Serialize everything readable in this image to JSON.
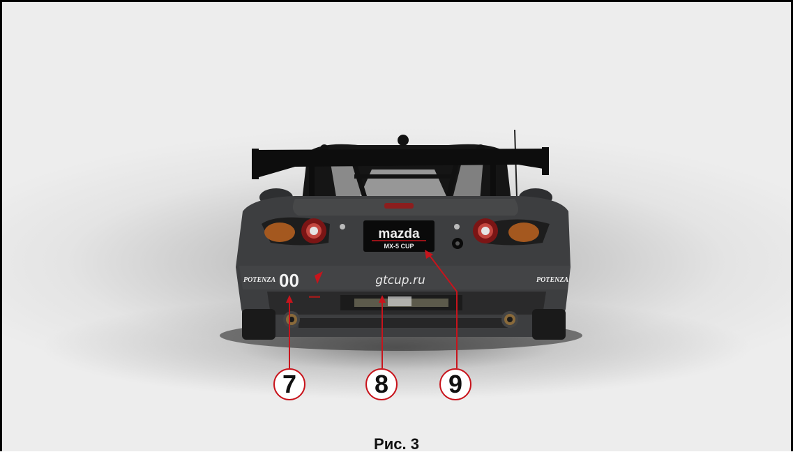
{
  "callouts": [
    {
      "label": "7"
    },
    {
      "label": "8"
    },
    {
      "label": "9"
    }
  ],
  "car": {
    "brand_logo": "mazda",
    "plate_sub": "MX-5 CUP",
    "website": "gtcup.ru",
    "number": "00",
    "tyre_brand_left": "POTENZA",
    "tyre_brand_right": "POTENZA"
  },
  "caption": "Рис. 3",
  "colors": {
    "accent_red": "#c8141c",
    "body": "#3d3e40",
    "background": "#e6e6e6"
  }
}
